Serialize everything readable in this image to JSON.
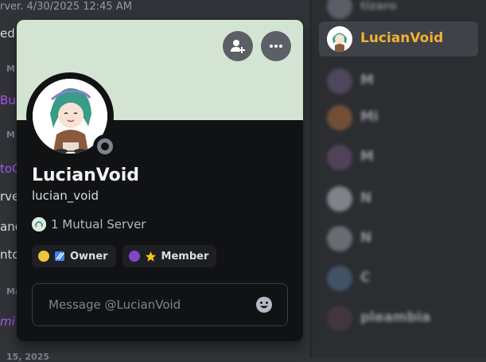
{
  "background_chat": {
    "timestamp_line": "rver. 4/30/2025 12:45 AM",
    "fragments": [
      "ed",
      "M",
      "Bu",
      "M",
      "toG",
      "rve",
      "and",
      "nto",
      "Ma",
      "mi",
      "M",
      "15, 2025"
    ]
  },
  "member_list": {
    "selected": {
      "name": "LucianVoid",
      "name_color": "#f0b232"
    },
    "others": [
      {
        "name": "tizaro"
      },
      {
        "name": "M"
      },
      {
        "name": "Mi"
      },
      {
        "name": "M"
      },
      {
        "name": "N"
      },
      {
        "name": "N"
      },
      {
        "name": "C"
      },
      {
        "name": "pleambia"
      }
    ]
  },
  "profile": {
    "banner_color": "#d4e4d3",
    "display_name": "LucianVoid",
    "username": "lucian_void",
    "status": "offline",
    "actions": {
      "add_friend_icon": "add-friend-icon",
      "more_icon": "more-options-icon"
    },
    "mutual_servers": "1 Mutual Server",
    "roles": [
      {
        "label": "Owner",
        "dot_color": "#f0c43c",
        "emoji": "flag-icon"
      },
      {
        "label": "Member",
        "dot_color": "#7d47c9",
        "emoji": "star-icon"
      }
    ],
    "message": {
      "placeholder": "Message @LucianVoid",
      "value": ""
    }
  }
}
